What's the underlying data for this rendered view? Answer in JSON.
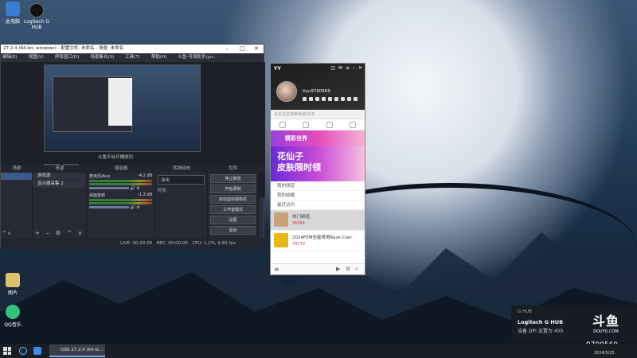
{
  "desktop": {
    "icons": [
      {
        "label": "此电脑",
        "icon": "computer-icon"
      },
      {
        "label": "Logitech G HUB",
        "icon": "logitech-icon"
      },
      {
        "label": "图片",
        "icon": "folder-icon"
      },
      {
        "label": "QQ音乐",
        "icon": "qq-music-icon"
      }
    ]
  },
  "obs": {
    "title": "27.2.4 (64-bit, windows) - 配置文件: 未命名 - 场景: 未命名",
    "menu": [
      "编辑(E)",
      "视图(V)",
      "停靠窗口(D)",
      "场景集合(S)",
      "工具(T)",
      "帮助(H)",
      "斗鱼-可视助手(yu..."
    ],
    "preview_status": "斗鱼平台开播成功",
    "preview_buttons": [
      "属性",
      "滤镜"
    ],
    "docks": {
      "headers": [
        "场景",
        "来源",
        "混音器",
        "转场特效",
        "控件"
      ],
      "sources": [
        "游戏源",
        "显示器采集 2"
      ],
      "mixer": [
        {
          "name": "麦克风/Aux",
          "db": "-4.2 dB"
        },
        {
          "name": "桌面音频",
          "db": "-1.2 dB"
        }
      ],
      "transition": "淡出",
      "transition_duration_label": "时长",
      "controls": [
        "停止推流",
        "开始录制",
        "启动虚拟摄像机",
        "工作室模式",
        "设置",
        "退出"
      ]
    },
    "status": {
      "live": "LIVE: 00:00:00",
      "rec": "REC: 00:00:00",
      "cpu": "CPU: 1.1%, 6.60 fps"
    }
  },
  "yy": {
    "logo": "YY",
    "username": "tiyu9700569",
    "search_placeholder": "点击这里搜索频道/好友",
    "banner1": "精彩世界",
    "banner2_line1": "花仙子",
    "banner2_line2": "皮肤限时领",
    "menu": [
      "我的频道",
      "我的收藏",
      "最近访问"
    ],
    "items": [
      {
        "title": "热门频道",
        "sub": "36584"
      },
      {
        "title": "2024FEM全能哥哥Raze Clan",
        "sub": "79770"
      }
    ]
  },
  "notification": {
    "app": "G HUB",
    "title": "Logitech G HUB",
    "message": "设备 DPI 设置为 400"
  },
  "watermark": {
    "brand": "斗鱼",
    "brand_sub": "DOUYU.COM",
    "room": "9700569"
  },
  "taskbar": {
    "obs_label": "OBS 27.2.4 (64-bi...",
    "date": "2024/5/25"
  }
}
